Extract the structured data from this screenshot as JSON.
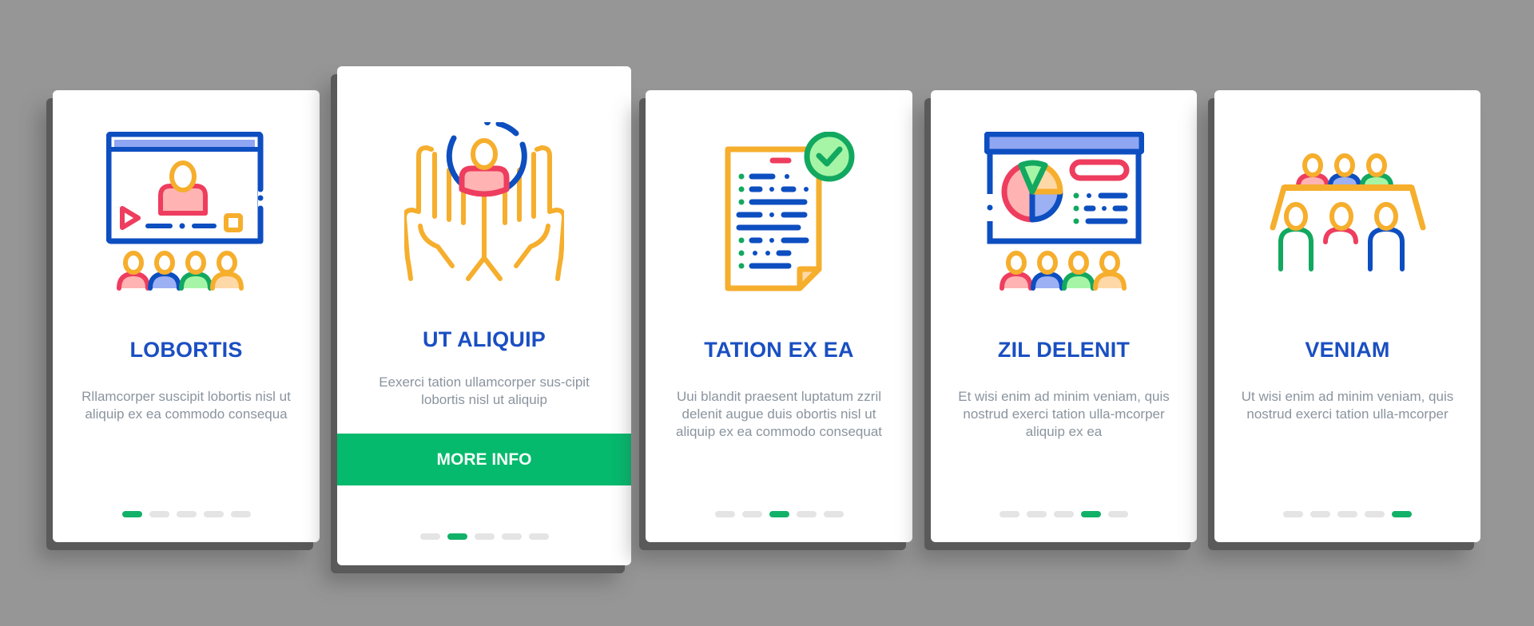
{
  "colors": {
    "background": "#969696",
    "title": "#1a4fc2",
    "description": "#8a949e",
    "accent_green": "#05b96d",
    "dot_inactive": "#e4e4e4",
    "dot_active": "#12b168"
  },
  "cards": [
    {
      "icon": "video-presentation-audience-icon",
      "title": "LOBORTIS",
      "description": "Rllamcorper suscipit lobortis nisl ut aliquip ex ea commodo consequa",
      "active_dot": 1,
      "total_dots": 5
    },
    {
      "icon": "hands-holding-person-icon",
      "title": "UT ALIQUIP",
      "description": "Eexerci tation ullamcorper sus-cipit lobortis nisl ut aliquip",
      "button_label": "MORE INFO",
      "active_dot": 2,
      "total_dots": 5
    },
    {
      "icon": "approved-document-icon",
      "title": "TATION EX EA",
      "description": "Uui blandit praesent luptatum zzril delenit augue duis obortis nisl ut aliquip ex ea commodo consequat",
      "active_dot": 3,
      "total_dots": 5
    },
    {
      "icon": "chart-presentation-audience-icon",
      "title": "ZIL DELENIT",
      "description": "Et wisi enim ad minim veniam, quis nostrud exerci tation ulla-mcorper aliquip ex ea",
      "active_dot": 4,
      "total_dots": 5
    },
    {
      "icon": "meeting-table-group-icon",
      "title": "VENIAM",
      "description": "Ut wisi enim ad minim veniam, quis nostrud exerci tation ulla-mcorper",
      "active_dot": 5,
      "total_dots": 5
    }
  ]
}
